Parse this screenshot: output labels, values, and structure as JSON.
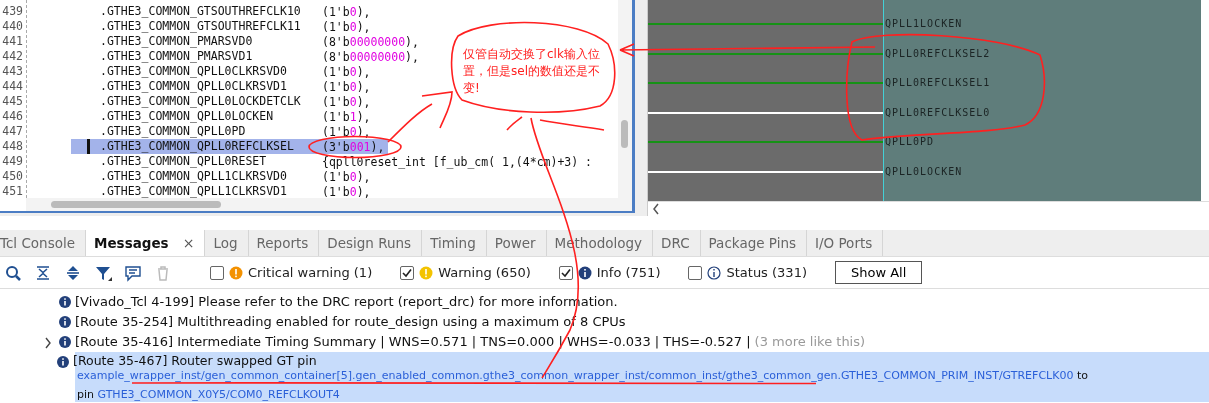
{
  "editor": {
    "lines": [
      {
        "number": "439",
        "name": ".GTHE3_COMMON_GTSOUTHREFCLK10",
        "pre": "(1'b",
        "digits": "0",
        "post": "),",
        "selected": false
      },
      {
        "number": "440",
        "name": ".GTHE3_COMMON_GTSOUTHREFCLK11",
        "pre": "(1'b",
        "digits": "0",
        "post": "),",
        "selected": false
      },
      {
        "number": "441",
        "name": ".GTHE3_COMMON_PMARSVD0",
        "pre": "(8'b",
        "digits": "00000000",
        "post": "),",
        "selected": false
      },
      {
        "number": "442",
        "name": ".GTHE3_COMMON_PMARSVD1",
        "pre": "(8'b",
        "digits": "00000000",
        "post": "),",
        "selected": false
      },
      {
        "number": "443",
        "name": ".GTHE3_COMMON_QPLL0CLKRSVD0",
        "pre": "(1'b",
        "digits": "0",
        "post": "),",
        "selected": false
      },
      {
        "number": "444",
        "name": ".GTHE3_COMMON_QPLL0CLKRSVD1",
        "pre": "(1'b",
        "digits": "0",
        "post": "),",
        "selected": false
      },
      {
        "number": "445",
        "name": ".GTHE3_COMMON_QPLL0LOCKDETCLK",
        "pre": "(1'b",
        "digits": "0",
        "post": "),",
        "selected": false
      },
      {
        "number": "446",
        "name": ".GTHE3_COMMON_QPLL0LOCKEN",
        "pre": "(1'b",
        "digits": "1",
        "post": "),",
        "selected": false
      },
      {
        "number": "447",
        "name": ".GTHE3_COMMON_QPLL0PD",
        "pre": "(1'b",
        "digits": "0",
        "post": "),",
        "selected": false
      },
      {
        "number": "448",
        "name": ".GTHE3_COMMON_QPLL0REFCLKSEL",
        "pre": "(3'b",
        "digits": "001",
        "post": "),",
        "selected": true
      },
      {
        "number": "449",
        "name": ".GTHE3_COMMON_QPLL0RESET",
        "pre": "{qpll0reset_int [f_ub_cm( 1,(4*cm)+3) :",
        "selected": false
      },
      {
        "number": "450",
        "name": ".GTHE3_COMMON_QPLL1CLKRSVD0",
        "pre": "(1'b",
        "digits": "0",
        "post": "),",
        "selected": false
      },
      {
        "number": "451",
        "name": ".GTHE3_COMMON_QPLL1CLKRSVD1",
        "pre": "(1'b",
        "digits": "0",
        "post": "),",
        "selected": false
      }
    ]
  },
  "schematic": {
    "pins": [
      {
        "label": "QPLL1LOCKEN",
        "color": "#169216"
      },
      {
        "label": "QPLL0REFCLKSEL2",
        "color": "#169216"
      },
      {
        "label": "QPLL0REFCLKSEL1",
        "color": "#169216"
      },
      {
        "label": "QPLL0REFCLKSEL0",
        "color": "#ffffff"
      },
      {
        "label": "QPLL0PD",
        "color": "#169216"
      },
      {
        "label": "QPLL0LOCKEN",
        "color": "#ffffff"
      }
    ]
  },
  "tabs": [
    {
      "label": "Tcl Console",
      "selected": false
    },
    {
      "label": "Messages",
      "selected": true,
      "close": "×"
    },
    {
      "label": "Log",
      "selected": false
    },
    {
      "label": "Reports",
      "selected": false
    },
    {
      "label": "Design Runs",
      "selected": false
    },
    {
      "label": "Timing",
      "selected": false
    },
    {
      "label": "Power",
      "selected": false
    },
    {
      "label": "Methodology",
      "selected": false
    },
    {
      "label": "DRC",
      "selected": false
    },
    {
      "label": "Package Pins",
      "selected": false
    },
    {
      "label": "I/O Ports",
      "selected": false
    }
  ],
  "filters": [
    {
      "kind": "critical",
      "label": "Critical warning (1)",
      "checked": false
    },
    {
      "kind": "warning",
      "label": "Warning (650)",
      "checked": true
    },
    {
      "kind": "info",
      "label": "Info (751)",
      "checked": true
    },
    {
      "kind": "status",
      "label": "Status (331)",
      "checked": false
    }
  ],
  "show_all_button": "Show All",
  "messages": [
    {
      "text": "[Vivado_Tcl 4-199] Please refer to the DRC report (report_drc) for more information.",
      "expandable": false,
      "selected": false
    },
    {
      "text": "[Route 35-254] Multithreading enabled for route_design using a maximum of 8 CPUs",
      "expandable": false,
      "selected": false
    },
    {
      "text": "[Route 35-416] Intermediate Timing Summary | WNS=0.571 | TNS=0.000 | WHS=-0.033 | THS=-0.527 |",
      "more": "(3 more like this)",
      "expandable": true,
      "selected": false
    },
    {
      "text": "[Route 35-467] Router swapped GT pin",
      "expandable": false,
      "selected": true,
      "detail": [
        {
          "kind": "link",
          "text": "example_wrapper_inst/gen_common_container[5].gen_enabled_common.gthe3_common_wrapper_inst/common_inst/gthe3_common_gen.GTHE3_COMMON_PRIM_INST/GTREFCLK00"
        },
        {
          "kind": "plain",
          "text": "to"
        },
        {
          "kind": "plain",
          "text": "pin"
        },
        {
          "kind": "link",
          "text": "GTHE3_COMMON_X0Y5/COM0_REFCLKOUT4"
        }
      ]
    }
  ],
  "annotation": {
    "note": "仅管自动交换了clk输入位置，但是sel的数值还是不变!"
  }
}
